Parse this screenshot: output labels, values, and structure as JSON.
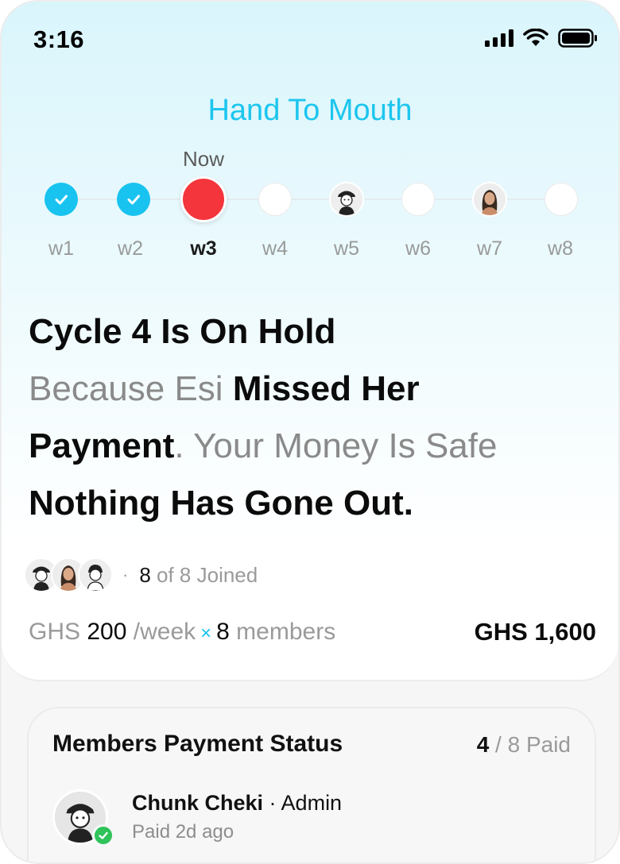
{
  "status_bar": {
    "time": "3:16"
  },
  "app": {
    "title": "Hand To Mouth"
  },
  "timeline": {
    "now_label": "Now",
    "weeks": [
      {
        "label": "w1",
        "state": "paid"
      },
      {
        "label": "w2",
        "state": "paid"
      },
      {
        "label": "w3",
        "state": "current"
      },
      {
        "label": "w4",
        "state": "upcoming"
      },
      {
        "label": "w5",
        "state": "member-avatar"
      },
      {
        "label": "w6",
        "state": "upcoming"
      },
      {
        "label": "w7",
        "state": "member-avatar"
      },
      {
        "label": "w8",
        "state": "upcoming"
      }
    ]
  },
  "headline": {
    "line1": "Cycle 4 Is On Hold",
    "part_because": "Because Esi ",
    "part_missed": "Missed Her",
    "part_payment": "Payment",
    "part_safe": ". Your Money Is Safe",
    "line4": "Nothing Has Gone Out."
  },
  "joined": {
    "separator": "·",
    "joined_count": "8",
    "joined_rest": " of 8 Joined"
  },
  "contribution": {
    "currency": "GHS ",
    "amount": "200",
    "period": " /week",
    "times": "×",
    "members_count": "8",
    "members_label": " members",
    "total": "GHS 1,600"
  },
  "members_card": {
    "title": "Members Payment Status",
    "paid_count": "4",
    "paid_rest": " / 8 Paid",
    "member": {
      "name": "Chunk Cheki",
      "role_sep": " · ",
      "role": "Admin",
      "status": "Paid 2d ago"
    }
  },
  "colors": {
    "accent": "#19c3ef",
    "current": "#f4353b",
    "verified": "#2fc35a"
  }
}
